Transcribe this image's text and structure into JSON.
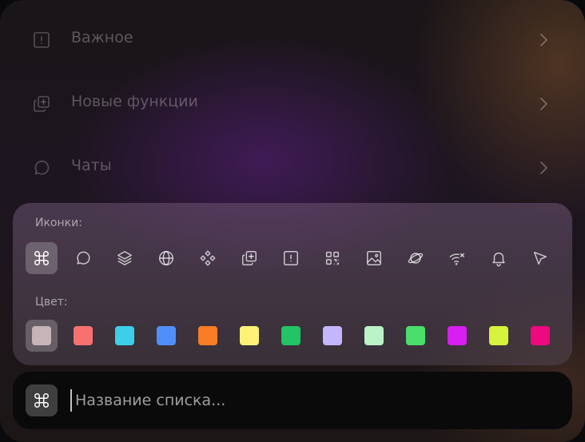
{
  "menu": {
    "items": [
      {
        "label": "Важное",
        "icon": "alert-square-icon"
      },
      {
        "label": "Новые функции",
        "icon": "copy-plus-icon"
      },
      {
        "label": "Чаты",
        "icon": "message-circle-icon"
      }
    ]
  },
  "picker": {
    "icons_label": "Иконки:",
    "color_label": "Цвет:",
    "icons": [
      "command-icon",
      "message-circle-icon",
      "layers-icon",
      "globe-icon",
      "component-icon",
      "copy-plus-icon",
      "alert-square-icon",
      "qr-code-icon",
      "image-icon",
      "planet-icon",
      "wifi-off-icon",
      "bell-icon",
      "send-icon"
    ],
    "selected_icon": "command-icon",
    "colors": [
      "#c7b4b9",
      "#f87171",
      "#3ecfe8",
      "#4f8ff7",
      "#f97d27",
      "#fef176",
      "#22c466",
      "#c4b5fd",
      "#bbf2c6",
      "#4ade6a",
      "#d81ef0",
      "#d5f23c",
      "#ec0a7e"
    ],
    "selected_color": "#c7b4b9"
  },
  "input": {
    "value": "",
    "placeholder": "Название списка..."
  }
}
